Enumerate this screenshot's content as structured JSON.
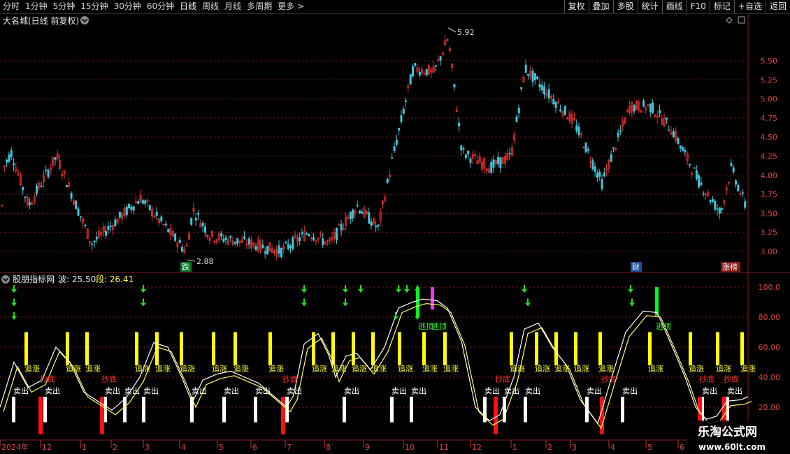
{
  "toolbar": {
    "periods": [
      "分时",
      "1分钟",
      "5分钟",
      "15分钟",
      "30分钟",
      "60分钟",
      "日线",
      "周线",
      "月线",
      "多周期",
      "更多 >"
    ],
    "active_period": "日线",
    "buttons": [
      "复权",
      "叠加",
      "多股",
      "统计",
      "画线",
      "F10",
      "标记",
      "+自选",
      "返回"
    ]
  },
  "main_chart": {
    "title": "大名城(日线 前复权)",
    "price_ticks": [
      "5.50",
      "5.25",
      "5.00",
      "4.75",
      "4.50",
      "4.25",
      "4.00",
      "3.75",
      "3.50",
      "3.25",
      "3.00"
    ],
    "high_marker": "5.92",
    "low_marker": "2.88",
    "tags": [
      "跌",
      "财",
      "涨榜"
    ]
  },
  "indicator": {
    "name": "股朋指标网",
    "wave_label": "波: 25.50",
    "segment_label": "段: 26.41",
    "ticks": [
      "100.0",
      "80.00",
      "60.00",
      "40.00",
      "20.00"
    ],
    "labels": {
      "chase": "追涨",
      "sell": "卖出",
      "bottom": "抄底",
      "escape": "逃顶"
    }
  },
  "time_axis": {
    "labels": [
      "2024年",
      "12",
      "1",
      "2",
      "3",
      "4",
      "5",
      "6",
      "7",
      "8",
      "9",
      "10",
      "11",
      "12",
      "1",
      "2",
      "3",
      "4",
      "5",
      "6"
    ]
  },
  "watermark": {
    "line1": "乐淘公式网",
    "line2": "www.60lt.com"
  },
  "colors": {
    "up": "#e03030",
    "down": "#3fc6d8",
    "bg": "#000000",
    "grid": "#6a1414",
    "accent": "#ffff00",
    "green": "#00d000"
  }
}
